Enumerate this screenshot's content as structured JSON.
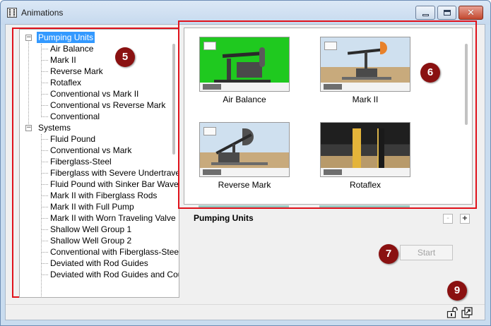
{
  "window": {
    "title": "Animations",
    "minimize_glyph": "",
    "maximize_glyph": "",
    "close_glyph": "✕"
  },
  "tree": {
    "groups": [
      {
        "label": "Pumping Units",
        "expander": "−",
        "selected": true,
        "children": [
          "Air Balance",
          "Mark II",
          "Reverse Mark",
          "Rotaflex",
          "Conventional vs Mark II",
          "Conventional vs Reverse Mark",
          "Conventional"
        ]
      },
      {
        "label": "Systems",
        "expander": "−",
        "selected": false,
        "children": [
          "Fluid Pound",
          "Conventional vs Mark",
          "Fiberglass-Steel",
          "Fiberglass with Severe Undertravel",
          "Fluid Pound with Sinker Bar Wave I",
          "Mark II with Fiberglass Rods",
          "Mark II with Full Pump",
          "Mark II with Worn Traveling Valve",
          "Shallow Well Group 1",
          "Shallow Well Group 2",
          "Conventional with Fiberglass-Steel a",
          "Deviated with Rod Guides",
          "Deviated with Rod Guides and Cou"
        ]
      }
    ]
  },
  "thumbnails": [
    {
      "caption": "Air Balance",
      "style": "green"
    },
    {
      "caption": "Mark II",
      "style": "desert"
    },
    {
      "caption": "Reverse Mark",
      "style": "desert"
    },
    {
      "caption": "Rotaflex",
      "style": "dark"
    }
  ],
  "section_title": "Pumping Units",
  "zoom_buttons": {
    "minus": "-",
    "plus": "+"
  },
  "start_button": {
    "label": "Start",
    "enabled": false
  },
  "callouts": {
    "tree": "5",
    "thumbs": "6",
    "start": "7",
    "dock": "9"
  },
  "colors": {
    "highlight": "#e0121b",
    "selection": "#3399ff",
    "callout": "#8a1111"
  },
  "icons": {
    "window": "filmstrip-icon",
    "unlock": "unlock-icon",
    "undock": "undock-icon"
  }
}
